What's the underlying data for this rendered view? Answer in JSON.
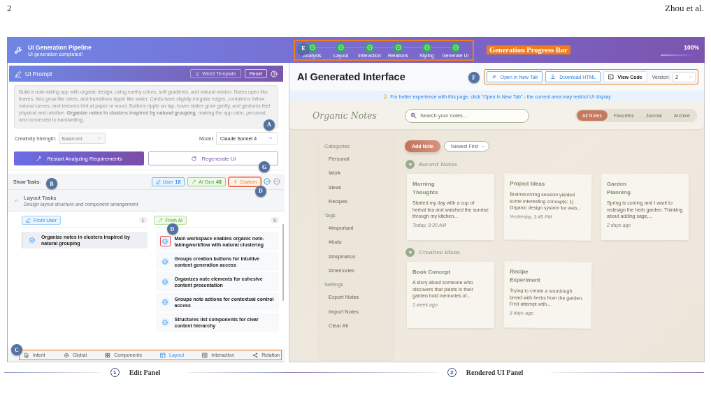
{
  "page_header": {
    "page_number": "2",
    "running_head": "Zhou et al."
  },
  "pipeline": {
    "title": "UI Generation Pipeline",
    "status": "UI generation completed!",
    "steps_callout": "E",
    "steps": [
      {
        "label": "Analysis",
        "done": true
      },
      {
        "label": "Layout",
        "done": true
      },
      {
        "label": "Interaction",
        "done": true
      },
      {
        "label": "Relations",
        "done": true
      },
      {
        "label": "Styling",
        "done": true
      },
      {
        "label": "Generate UI",
        "done": true
      }
    ],
    "label": "Generation Progress Bar",
    "percent": "100%",
    "level": 1
  },
  "edit_panel": {
    "prompt": {
      "title": "UI Prompt",
      "callout": "A",
      "buttons": [
        {
          "kind": "template",
          "label": "Web3 Template",
          "disabled": true
        },
        {
          "kind": "reset",
          "label": "Reset",
          "disabled": false
        }
      ],
      "text": "Build a note-taking app with organic design, using earthy colors, soft gradients, and natural motion. Notes open like leaves, lists grow like vines, and transitions ripple like water. Cards have slightly irregular edges, containers follow natural curves, and textures hint at paper or wood. Buttons ripple on tap, hover states grow gently, and gestures feel physical and intuitive. **Organize notes in clusters inspired by natural grouping**, making the app calm, personal, and connected to handwriting."
    },
    "creativity": {
      "label": "Creativity Strength:",
      "value": "Balanced",
      "disabled": true
    },
    "model": {
      "label": "Model:",
      "value": "Claude Sonnet 4"
    },
    "actions": [
      {
        "kind": "primary",
        "label": "Restart Analyzing Requirements"
      },
      {
        "kind": "secondary",
        "label": "Regenerate UI",
        "callout": "G"
      }
    ],
    "tasks": {
      "label": "Show Tasks:",
      "callout": "B",
      "filters": [
        {
          "kind": "user",
          "label": "User",
          "count": "18"
        },
        {
          "kind": "ai",
          "label": "AI Gen",
          "count": "48"
        },
        {
          "kind": "custom",
          "label": "Custom",
          "callout": "D"
        }
      ],
      "group": {
        "title": "Layout Tasks",
        "subtitle": "Design layout structure and component arrangement",
        "expanded": true
      },
      "columns": [
        {
          "kind": "user",
          "label": "From User",
          "count": "1",
          "items": [
            {
              "text": "Organize notes in clusters inspired by natural grouping"
            }
          ]
        },
        {
          "kind": "ai",
          "label": "From AI",
          "count": "9",
          "items": [
            {
              "text": "Main workspace enables organic note-takingworkflow with natural clustering",
              "callout": "D"
            },
            {
              "text": "Groups creation buttons for intuitive content generation access"
            },
            {
              "text": "Organizes note elements for cohesive content presentation"
            },
            {
              "text": "Groups note actions for contextual control access"
            },
            {
              "text": "Structures list components for clear content hierarchy"
            }
          ]
        }
      ]
    },
    "tabs_callout": "C",
    "tabs": [
      {
        "kind": "intent",
        "label": "Intent",
        "selected": false
      },
      {
        "kind": "global",
        "label": "Global",
        "selected": false
      },
      {
        "kind": "components",
        "label": "Components",
        "selected": false
      },
      {
        "kind": "layout",
        "label": "Layout",
        "selected": true
      },
      {
        "kind": "interaction",
        "label": "Interaction",
        "selected": false
      },
      {
        "kind": "relation",
        "label": "Relation",
        "selected": false
      }
    ]
  },
  "rendered_panel": {
    "title": "AI Generated Interface",
    "callout": "F",
    "toolbar": [
      {
        "kind": "link",
        "label": "Open in New Tab"
      },
      {
        "kind": "download",
        "label": "Download HTML"
      },
      {
        "kind": "code",
        "label": "View Code"
      }
    ],
    "version": {
      "label": "Version:",
      "value": "2"
    },
    "notice": "For better experience with this page, click \"Open in New Tab\" - the current area may restrict UI display",
    "app": {
      "logo": "Organic Notes",
      "search_placeholder": "Search your notes...",
      "nav": [
        {
          "label": "All Notes",
          "selected": true
        },
        {
          "label": "Favorites",
          "selected": false
        },
        {
          "label": "Journal",
          "selected": false
        },
        {
          "label": "Archive",
          "selected": false
        }
      ],
      "sidebar": [
        {
          "title": "Categories",
          "items": [
            "Personal",
            "Work",
            "Ideas",
            "Recipes"
          ]
        },
        {
          "title": "Tags",
          "items": [
            "#important",
            "#todo",
            "#inspiration",
            "#memories"
          ]
        },
        {
          "title": "Settings",
          "items": [
            "Export Notes",
            "Import Notes",
            "Clear All"
          ]
        }
      ],
      "add_button": "Add Note",
      "sort": "Newest First",
      "sections": [
        {
          "title": "Recent Notes",
          "expanded": true,
          "notes": [
            {
              "title": "Morning Thoughts",
              "body": "Started my day with a cup of herbal tea and watched the sunrise through my kitchen...",
              "time": "Today, 8:30 AM"
            },
            {
              "title": "Project Ideas",
              "body": "Brainstorming session yielded some interesting concepts: 1) Organic design system for web...",
              "time": "Yesterday, 3:45 PM"
            },
            {
              "title": "Garden Planning",
              "body": "Spring is coming and I want to redesign the herb garden. Thinking about adding sage,...",
              "time": "2 days ago"
            }
          ]
        },
        {
          "title": "Creative Ideas",
          "expanded": true,
          "notes": [
            {
              "title": "Book Concept",
              "body": "A story about someone who discovers that plants in their garden hold memories of...",
              "time": "1 week ago"
            },
            {
              "title": "Recipe Experiment",
              "body": "Trying to create a sourdough bread with herbs from the garden. First attempt with...",
              "time": "3 days ago"
            }
          ]
        }
      ]
    }
  },
  "captions": [
    {
      "number": "1",
      "label": "Edit Panel"
    },
    {
      "number": "2",
      "label": "Rendered UI Panel"
    }
  ]
}
